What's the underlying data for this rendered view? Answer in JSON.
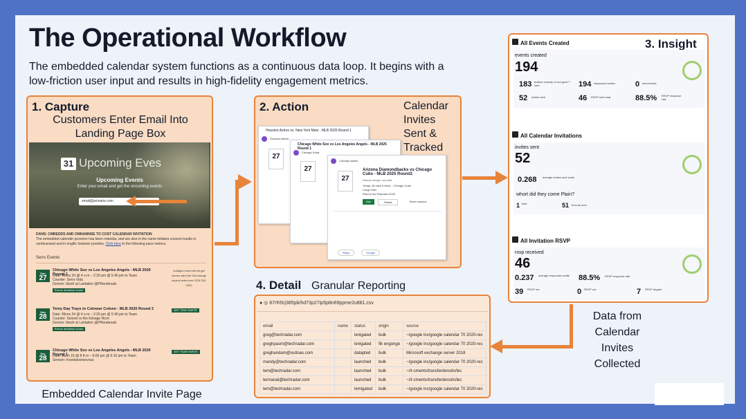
{
  "title": "The Operational Workflow",
  "subtitle": "The embedded calendar system functions as a continuous data loop. It begins with a low-friction user input and results in high-fidelity engagement metrics.",
  "capture": {
    "title": "1. Capture",
    "desc": "Customers Enter Email Into Landing Page Box",
    "caption": "Embedded Calendar Invite Page",
    "hero_day": "31",
    "hero_title": "Upcoming Eves",
    "hero_sub": "Upcoming Events",
    "hero_line": "Enter your email and get the oncoming events",
    "email_value": "email@acmarie.com",
    "notice_title": "DANS: CMBEDDS AND OMNAMNSE TO COST CALENDAR INVITATION",
    "notice_text": "The embedded calender proveion has been relandar, and are also in the name initiates cnsood results in continuesiod and in engific footneer proeties.",
    "notice_link": "Click here",
    "notice_tail": " to the following pace metrics.",
    "section": "Serrs Events",
    "events": [
      {
        "mon": "Dan",
        "day": "27",
        "title": "Chicago White Sox vs Los Angeles Angels - MLB 2020 Round 1",
        "l1": "Date: Rlons 24 @ 4 s·m – 2:30 pm @ 5:40 pm to Team",
        "l2": "Counter: Serrs Vida",
        "l3": "Gonom: Ibosh at Lantation @PRendesals",
        "btn": "Ermoe doriatirse ircose",
        "side": "Indidgeo event tert be get somen said hire Get simuge expem bettu from OCB 228, 2020"
      },
      {
        "mon": "Dan",
        "day": "28",
        "title": "Temy Day Trays to Cotowar Colone - MLB 2020 Round 2",
        "l1": "Date: Rlons 24 @ 4 s·m – 2:30 pm @ 5:40 pm to Team",
        "l2": "Counter: Seiond vs the Elmage Ricm",
        "l3": "Gonom: Ibosh at Lantation @PRendesals",
        "btn": "Ermoe doriatirse ircose",
        "side": "GET TRAY NVETE"
      },
      {
        "mon": "Dac",
        "day": "28",
        "title": "Chicago White Sox vs Los Angeles Angels - MLB 2020 Round 1",
        "l1": "Date: Abon 16 @ 8 ft m – 6:00 pm @ 6:10 pm to Team",
        "l2": "Senson: Incedanseisevous",
        "l3": "",
        "btn": "",
        "side": "GET TEAR NVNTE"
      }
    ]
  },
  "action": {
    "title": "2. Action",
    "desc": "Calendar Invites Sent & Tracked",
    "card1_title": "Houston Astros vs. New York Mets - MLB 2025 Round 1",
    "card1_org": "Houston Astros",
    "card2_title": "Chicago White Sox vs Los Angeles Angels - MLB 2025 Round 1",
    "card2_org": "Chicago Sotra",
    "card3_org": "Cotowye Aslins",
    "card3_title": "Arizona Diamondbacks vs Chicago Cubs - MLB 2025 Round1",
    "card3_meta": "Nelody  belogin ronodalt",
    "card3_when": "Yeday, 18 mins 5 Mom – Chicago Cube",
    "card3_where": "Cargo Sitei",
    "card3_who": "Ravron dor Rdorsiee 2025",
    "card3_btn_ask": "Ask",
    "card3_btn_seeds": "Seeds",
    "card3_more": "More reasons",
    "cal_day": "27",
    "reply": "Reply",
    "google": "Google"
  },
  "insight": {
    "title": "3. Insight",
    "events": {
      "head": "All Events Created",
      "label": "events created",
      "value": "194",
      "s1v": "183",
      "s1l": "buiikse cmomip m tod gueil T coer",
      "s2v": "194",
      "s2l": "responses invites",
      "s3v": "0",
      "s3l": "next events",
      "s4v": "52",
      "s4l": "invites sent",
      "s5v": "46",
      "s5l": "RSVP sent seat",
      "s6v": "88.5%",
      "s6l": "RSVP response rate"
    },
    "invites": {
      "head": "All Calendar Invitations",
      "label": "invites sent",
      "value": "52",
      "avg_v": "0.268",
      "avg_l": "average invites sent sents",
      "question": "whort did they come Plain?",
      "q1v": "1",
      "q1l": "fosh",
      "q2v": "51",
      "q2l": "from tiy sool"
    },
    "rsvp": {
      "head": "All Invitation RSVP",
      "label": "rsvp received",
      "value": "46",
      "r1v": "0.237",
      "r1l": "average responses outtle",
      "r2v": "88.5%",
      "r2l": "RSVP response rate",
      "r3v": "39",
      "r3l": "RSVP res",
      "r4v": "0",
      "r4l": "RSVP ros",
      "r5v": "7",
      "r5l": "RSVP degree"
    }
  },
  "detail": {
    "title": "4. Detail",
    "desc": "Granular Reporting",
    "file": "87rfri5rj385pb/hd73p27ip5p8n69ppme2u881.csv",
    "columns": [
      "email",
      "name",
      "status",
      "origin",
      "source"
    ],
    "rows": [
      [
        "greg@techradar.com",
        "",
        "lenigated",
        "bulk",
        "~/google inc/google calendar 70 2020-rec"
      ],
      [
        "greghpasm@techradar.com",
        "",
        "lenigated",
        "fik engonge",
        "~/google inc/google calendar 70 2020-rec"
      ],
      [
        "greghandam@outloas.com",
        "",
        "datapted",
        "bulk",
        "Microsoft exchange server 2018"
      ],
      [
        "mandy@techradar.com",
        "",
        "launched",
        "bulk",
        "~/google inc/google calendar 70 2020-rec"
      ],
      [
        "tem@techradar.com",
        "",
        "launched",
        "bulk",
        "~//t-cments/transferdensits/lec"
      ],
      [
        "termaraii@techradar.com",
        "",
        "launched",
        "bulk",
        "~//t-cments/transferdensits/lec"
      ],
      [
        "tem@techradar.com",
        "",
        "lemigated",
        "bulk",
        "~/google inc/google calendar 70 2020-rec"
      ]
    ]
  },
  "collected": "Data from Calendar Invites Collected",
  "colors": {
    "accent": "#e8833a",
    "frame": "#4f72c6",
    "panel": "#f9dcc3",
    "green": "#1c5e3b"
  },
  "icons": [
    "calendar-icon",
    "check-circle-icon",
    "envelope-icon",
    "arrow-right-icon",
    "arrow-left-icon"
  ]
}
